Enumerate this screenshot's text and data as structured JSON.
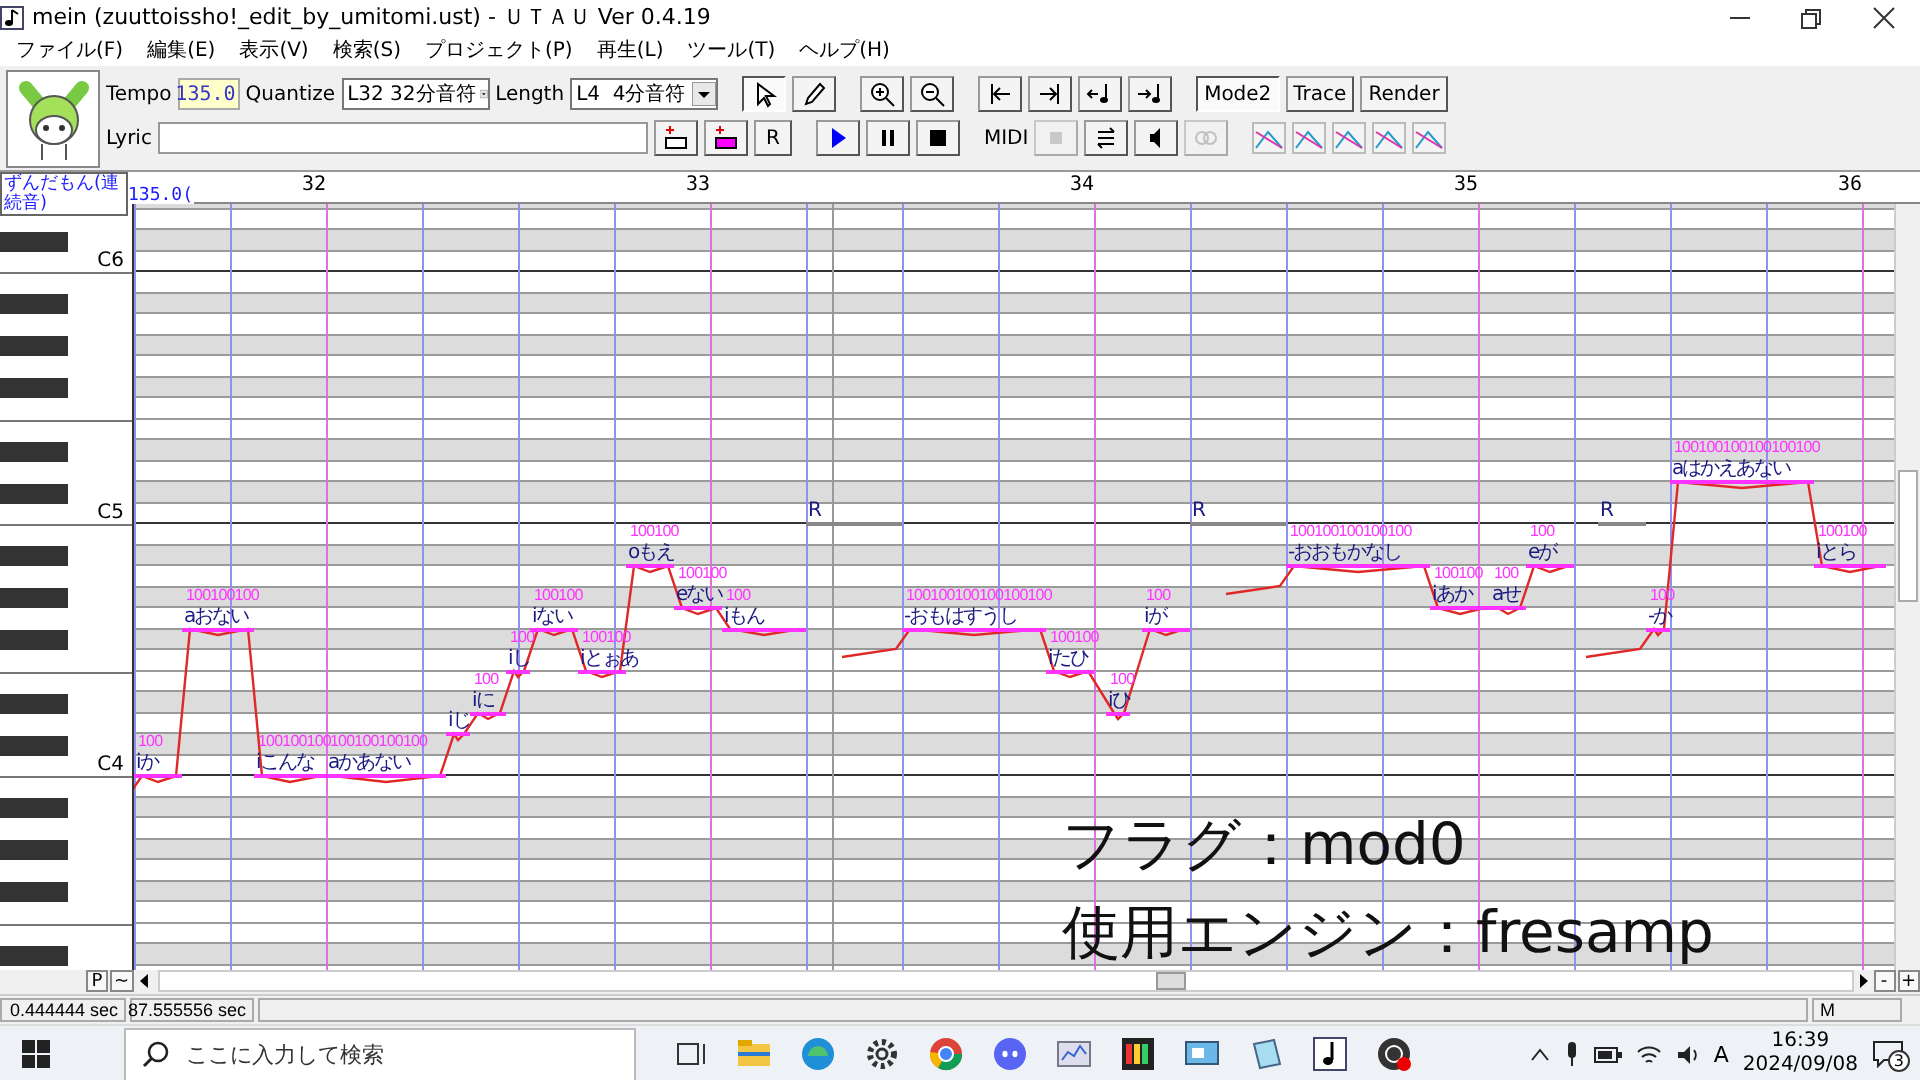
{
  "window": {
    "title": "mein (zuuttoissho!_edit_by_umitomi.ust) - ＵＴＡＵ Ver 0.4.19"
  },
  "menu": [
    "ファイル(F)",
    "編集(E)",
    "表示(V)",
    "検索(S)",
    "プロジェクト(P)",
    "再生(L)",
    "ツール(T)",
    "ヘルプ(H)"
  ],
  "toolbar": {
    "tempo_label": "Tempo",
    "tempo": "135.0",
    "quantize_label": "Quantize",
    "quantize": "L32 32分音符",
    "length_label": "Length",
    "length": "L4  4分音符",
    "lyric_label": "Lyric",
    "midi_label": "MIDI",
    "rest_glyph": "R",
    "mode_buttons": [
      {
        "label": "Mode2",
        "pressed": true
      },
      {
        "label": "Trace",
        "pressed": false
      },
      {
        "label": "Render",
        "pressed": false
      }
    ]
  },
  "ruler": {
    "singer": "ずんだもん(連続音)",
    "tempo_mark": "135.0(",
    "measures": [
      "32",
      "33",
      "34",
      "35",
      "36"
    ]
  },
  "keyboard": {
    "octave_labels": [
      "C6",
      "C5",
      "C4"
    ]
  },
  "notes": [
    {
      "kind": "note",
      "lyric": "iか",
      "velocity": "100"
    },
    {
      "kind": "note",
      "lyric": "aおない",
      "velocity": "100100100"
    },
    {
      "kind": "note",
      "lyric": "iこんな",
      "velocity": "100100100"
    },
    {
      "kind": "note",
      "lyric": "aかあない",
      "velocity": "100100100100"
    },
    {
      "kind": "note",
      "lyric": "iじ"
    },
    {
      "kind": "note",
      "lyric": "iに",
      "velocity": "100"
    },
    {
      "kind": "note",
      "lyric": "iし",
      "velocity": "100"
    },
    {
      "kind": "note",
      "lyric": "iない",
      "velocity": "100100"
    },
    {
      "kind": "note",
      "lyric": "iとぉあ",
      "velocity": "100100"
    },
    {
      "kind": "note",
      "lyric": "oもえ",
      "velocity": "100100"
    },
    {
      "kind": "note",
      "lyric": "eない",
      "velocity": "100100"
    },
    {
      "kind": "note",
      "lyric": "iもん",
      "velocity": "100"
    },
    {
      "kind": "rest",
      "lyric": "R"
    },
    {
      "kind": "note",
      "lyric": "-おもはすうし",
      "velocity": "100100100100100100"
    },
    {
      "kind": "note",
      "lyric": "iたひ",
      "velocity": "100100"
    },
    {
      "kind": "note",
      "lyric": "iひ",
      "velocity": "100"
    },
    {
      "kind": "note",
      "lyric": "iが",
      "velocity": "100"
    },
    {
      "kind": "rest",
      "lyric": "R"
    },
    {
      "kind": "note",
      "lyric": "-おおもかなし",
      "velocity": "100100100100100"
    },
    {
      "kind": "note",
      "lyric": "iあか",
      "velocity": "100100"
    },
    {
      "kind": "note",
      "lyric": "aせ",
      "velocity": "100"
    },
    {
      "kind": "note",
      "lyric": "eが",
      "velocity": "100"
    },
    {
      "kind": "rest",
      "lyric": "R"
    },
    {
      "kind": "note",
      "lyric": "-か",
      "velocity": "100"
    },
    {
      "kind": "note",
      "lyric": "aはかえあない",
      "velocity": "100100100100100100"
    },
    {
      "kind": "note",
      "lyric": "iとら",
      "velocity": "100100"
    }
  ],
  "caption": [
    "フラグ：mod0",
    "使用エンジン：fresamp"
  ],
  "scroll_bar": {
    "p_button": "P",
    "tilde_button": "~",
    "minus": "-",
    "plus": "+"
  },
  "status_bar": [
    "0.444444 sec",
    "87.555556 sec",
    "M"
  ],
  "taskbar": {
    "search_placeholder": "ここに入力して検索",
    "ime": "A",
    "time": "16:39",
    "date": "2024/09/08",
    "notifications": "3"
  }
}
